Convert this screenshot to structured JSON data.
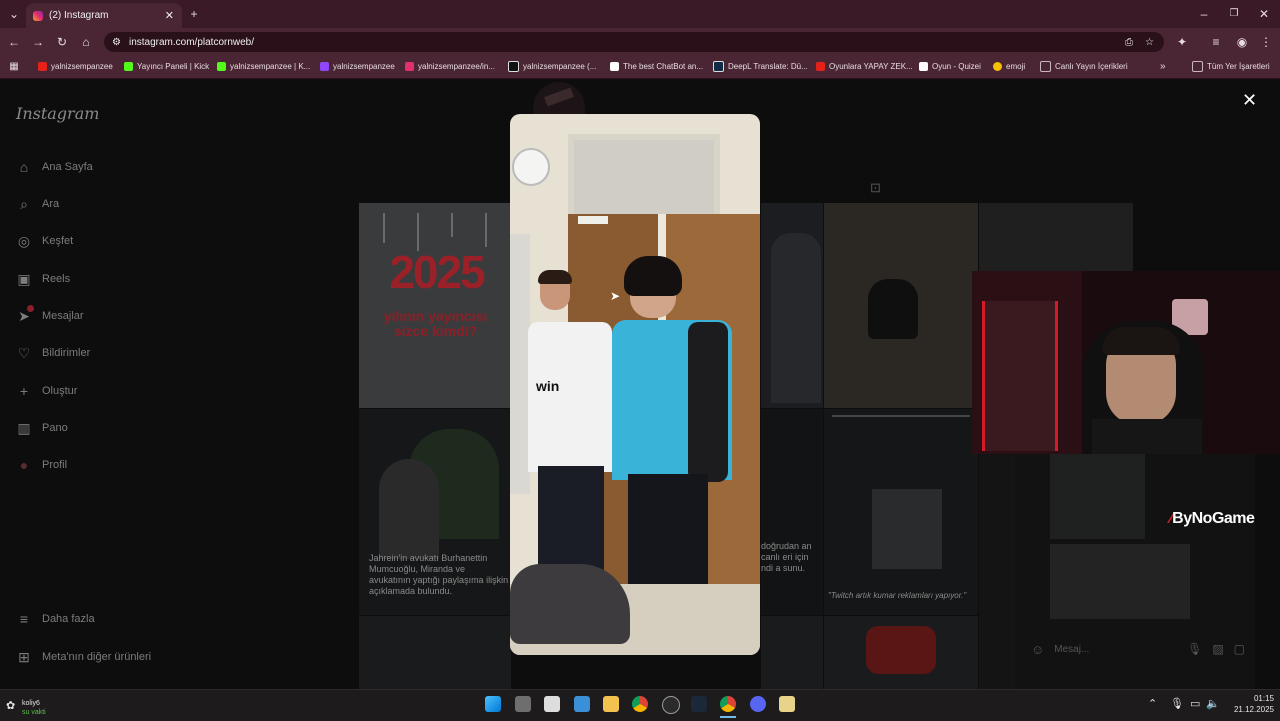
{
  "browser": {
    "tab_title": "(2) Instagram",
    "url": "instagram.com/platcornweb/",
    "bookmarks": [
      {
        "label": "yalnizsempanzee",
        "color": "#e62117"
      },
      {
        "label": "Yayıncı Paneli | Kick",
        "color": "#53fc18"
      },
      {
        "label": "yalnizsempanzee | K...",
        "color": "#53fc18"
      },
      {
        "label": "yalnizsempanzee",
        "color": "#9146ff"
      },
      {
        "label": "yalnizsempanzee/in...",
        "color": "#e1306c"
      },
      {
        "label": "yalnizsempanzee (...",
        "color": "#ffffff"
      },
      {
        "label": "The best ChatBot an...",
        "color": "#ffffff"
      },
      {
        "label": "DeepL Translate: Dü...",
        "color": "#0f2b46"
      },
      {
        "label": "Oyunlara YAPAY ZEK...",
        "color": "#e62117"
      },
      {
        "label": "Oyun - Quizei",
        "color": "#ffffff"
      },
      {
        "label": "emoji",
        "color": "#f5c000"
      },
      {
        "label": "Canlı Yayın İçerikleri",
        "color": "#c9b6bd"
      }
    ],
    "all_bookmarks": "Tüm Yer İşaretleri"
  },
  "instagram": {
    "logo": "Instagram",
    "nav": [
      {
        "label": "Ana Sayfa",
        "icon": "⌂"
      },
      {
        "label": "Ara",
        "icon": "⌕"
      },
      {
        "label": "Keşfet",
        "icon": "◎"
      },
      {
        "label": "Reels",
        "icon": "▣"
      },
      {
        "label": "Mesajlar",
        "icon": "➤"
      },
      {
        "label": "Bildirimler",
        "icon": "♡"
      },
      {
        "label": "Oluştur",
        "icon": "+"
      },
      {
        "label": "Pano",
        "icon": "▥"
      },
      {
        "label": "Profil",
        "icon": "●"
      }
    ],
    "more": "Daha fazla",
    "meta": "Meta'nın diğer ürünleri",
    "tile_texts": {
      "year": "2025",
      "year_question": "yılının yayıncısı sizce kimdi?",
      "lawyer_text": "Jahrein'in avukatı Burhanettin Mumcuoğlu, Miranda ve avukatının yaptığı paylaşıma ilişkin açıklamada bulundu.",
      "twitch_quote": "\"Twitch artık kumar reklamları yapıyor.\"",
      "partial": "doğrudan an canlı eri için ndi a sunu."
    },
    "message_placeholder": "Mesaj..."
  },
  "overlay": {
    "sponsor": "ByNoGame"
  },
  "taskbar": {
    "user_name": "koliy6",
    "user_status": "su vakti",
    "time": "01:15",
    "date": "21.12.2025"
  }
}
